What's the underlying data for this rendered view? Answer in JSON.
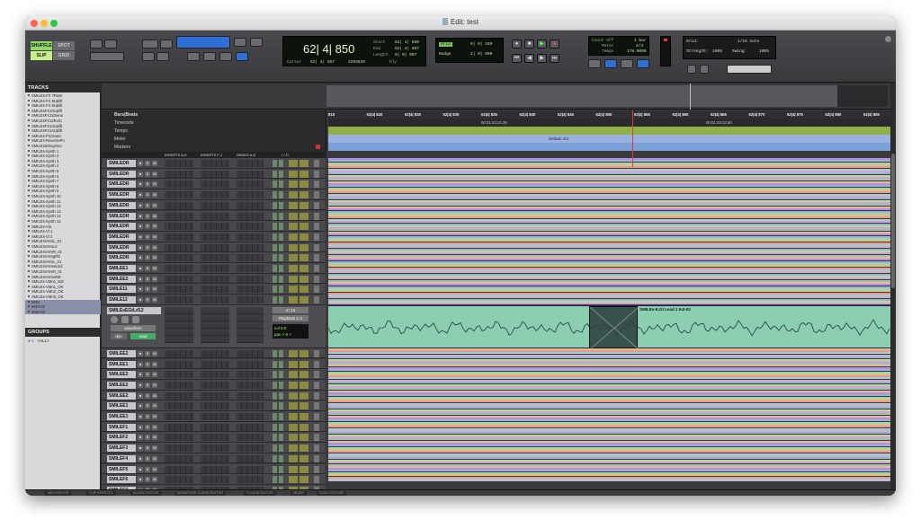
{
  "window": {
    "title": "Edit: test"
  },
  "toolbar": {
    "modes": [
      "SHUFFLE",
      "SPOT",
      "SLIP",
      "GRID"
    ],
    "counter": {
      "main": "62| 4| 850",
      "cursor_label": "Cursor",
      "cursor_value": "62| 4| 857",
      "sample_value": "2293828",
      "start_label": "Start",
      "start_value": "62| 4| 850",
      "end_label": "End",
      "end_value": "62| 4| 857",
      "length_label": "Length",
      "length_value": "0| 0| 007",
      "dly_label": "Dly"
    },
    "grid": {
      "grid_label": "Grid",
      "grid_value": "0| 0| 240",
      "nudge_label": "Nudge",
      "nudge_value": "1| 0| 000"
    },
    "midi": {
      "count_off": "Count Off",
      "meter_label": "Meter",
      "meter_value": "4/4",
      "bar_value": "1 bar",
      "tempo_label": "Tempo",
      "tempo_value": "178.0000"
    },
    "quantize": {
      "grid_label": "Grid:",
      "grid_value": "1/16 note",
      "strength_label": "Strength:",
      "strength_value": "100%",
      "swing_label": "Swing:",
      "swing_value": "100%"
    }
  },
  "left_panel": {
    "tracks_header": "TRACKS",
    "tracks": [
      "SMILEs-FX 7Riser",
      "SMILEs-FX 8Uplift",
      "SMILEs-FX 9Uplift",
      "SMILEsFX10Uplift",
      "SMILEsFX11Dwns",
      "SMILEsFX12RvrC",
      "SMILEsFX13Uplift",
      "SMILEsFX14Uplift",
      "SMILEs-Pizzicato",
      "SMILEs-ReversePn",
      "SMILEsStringsSci",
      "SMILEs-Synth 1",
      "SMILEs-Synth 2",
      "SMILEs-Synth 3",
      "SMILEs-Synth 4",
      "SMILEs-Synth 5",
      "SMILEs-Synth 6",
      "SMILEs-Synth 7",
      "SMILEs-Synth 8",
      "SMILEs-Synth 9",
      "SMILEs-Synth 10",
      "SMILEs-Synth 11",
      "SMILEs-Synth 12",
      "SMILEs-Synth 13",
      "SMILEs-Synth 14",
      "SMILEs-Synth 15",
      "SMILEs-Vla",
      "SMILEs-Vl 1",
      "SMILEs-Vl 2",
      "SMILEsVHmL_01",
      "SMILEsVHmL2",
      "SMILEsVHmR_01",
      "SMILEsVHmgRE",
      "SMILEsVHmL_01",
      "SMILEsVHmwLEd",
      "SMILEsVHmR_01",
      "SMILEsVHmwRE",
      "SMILEs-VMn1_Edt",
      "SMILEs-VMn1_OK",
      "SMILEs-VMn2_OK",
      "SMILEs-VMn3_OK",
      "MIDI",
      "MIDI-02",
      "MIDI-03"
    ],
    "groups_header": "GROUPS",
    "group_all": "<ALL>"
  },
  "rulers": {
    "bars_beats": "Bars|Beats",
    "timecode": "Timecode",
    "tempo": "Tempo",
    "meter": "Meter",
    "markers": "Markers",
    "ticks": [
      "815",
      "62|4| 820",
      "62|4| 825",
      "62|4| 830",
      "62|4| 835",
      "62|4| 840",
      "62|4| 845",
      "62|4| 850",
      "62|4| 855",
      "62|4| 860",
      "62|4| 865",
      "62|4| 870",
      "62|4| 875",
      "62|4| 880",
      "62|4| 885"
    ],
    "tc1": "00:01:23:13.25",
    "tc2": "00:01:23:13.50",
    "meter_default": "Default: 4/4"
  },
  "columns": {
    "inserts_ae": "INSERTS A-E",
    "inserts_fj": "INSERTS F-J",
    "sends_ae": "SENDS A-E",
    "io": "I / O"
  },
  "edit_tracks": {
    "top": [
      "SMILEDR",
      "SMILEDR",
      "SMILEDR",
      "SMILEDR",
      "SMILEDR",
      "SMILEDR",
      "SMILEDR",
      "SMILEDR",
      "SMILEDR",
      "SMILEDR",
      "SMILEE1",
      "SMILEE2",
      "SMILE11",
      "SMILE12"
    ],
    "bottom": [
      "SMILEE2",
      "SMILEE1",
      "SMILEE2",
      "SMILEE2",
      "SMILEE2",
      "SMILEE1",
      "SMILEE1",
      "SMILEF1",
      "SMILEF2",
      "SMILEF3",
      "SMILEF4",
      "SMILEF5",
      "SMILEF6",
      "SMILEF7"
    ],
    "solo_mute": "S M"
  },
  "selected_track": {
    "name": "SMILEsEGtLd12",
    "view": "waveform",
    "dyn": "dyn",
    "mode": "read",
    "input": "In 13",
    "output": "Playback 1-2",
    "vol_label": "vol",
    "vol_value": "0.0",
    "pan_label": "pan",
    "pan_value": "> 0 <",
    "clip_name": "SMILEs-E.Gt Lead 1 In2-02"
  },
  "bottom_tabs": [
    "MIDI EDITOR",
    "CLIP EFFECTS",
    "SCORE EDITOR",
    "SIGNATURE CURVE EDITOR",
    "PLUGIN EDITOR",
    "MIXER",
    "VIDEO EDITOR"
  ],
  "lane_colors": [
    "#b98fd8",
    "#9ab0e0",
    "#9ad8a8",
    "#e0c080",
    "#e89898",
    "#a0d0c8",
    "#d8a8d0",
    "#8fb8d8",
    "#c0d890",
    "#d0a0e0",
    "#98c8a8",
    "#e8b8a0"
  ]
}
